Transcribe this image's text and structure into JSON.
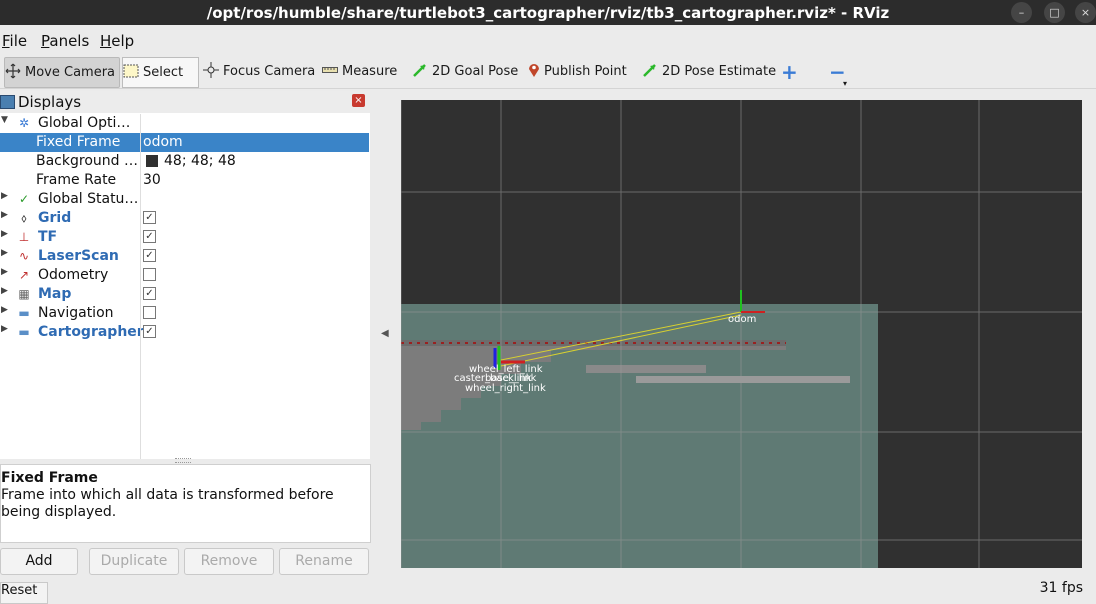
{
  "window": {
    "title": "/opt/ros/humble/share/turtlebot3_cartographer/rviz/tb3_cartographer.rviz* - RViz",
    "minimize": "–",
    "maximize": "□",
    "close": "×"
  },
  "menu": [
    "File",
    "Panels",
    "Help"
  ],
  "toolbar": {
    "move_camera": "Move Camera",
    "select": "Select",
    "focus_camera": "Focus Camera",
    "measure": "Measure",
    "goal_pose": "2D Goal Pose",
    "publish_point": "Publish Point",
    "pose_estimate": "2D Pose Estimate",
    "add_tool": "+",
    "remove_tool": "−"
  },
  "displays": {
    "title": "Displays",
    "close": "×",
    "tree": {
      "global_options": "Global Opti…",
      "fixed_frame_label": "Fixed Frame",
      "fixed_frame_value": "odom",
      "background_label": "Background …",
      "background_value": "48; 48; 48",
      "frame_rate_label": "Frame Rate",
      "frame_rate_value": "30",
      "global_status": "Global Statu…",
      "grid": "Grid",
      "tf": "TF",
      "laserscan": "LaserScan",
      "odometry": "Odometry",
      "map": "Map",
      "navigation": "Navigation",
      "cartographer": "Cartographer"
    },
    "checks": {
      "grid": true,
      "tf": true,
      "laserscan": true,
      "odometry": false,
      "map": true,
      "navigation": false,
      "cartographer": true
    }
  },
  "description": {
    "heading": "Fixed Frame",
    "body": "Frame into which all data is transformed before being displayed."
  },
  "buttons": {
    "add": "Add",
    "duplicate": "Duplicate",
    "remove": "Remove",
    "rename": "Rename",
    "reset": "Reset"
  },
  "viewport": {
    "labels": {
      "odom": "odom",
      "wheel_left": "wheel_left_link",
      "caster": "caster_back_link",
      "base": "base_link",
      "wheel_right": "wheel_right_link"
    }
  },
  "status": {
    "fps": "31 fps"
  },
  "colors": {
    "background": "#303030",
    "map_free": "#5f7a74",
    "selection": "#3a84c8",
    "blue_label": "#2f6bb3"
  }
}
